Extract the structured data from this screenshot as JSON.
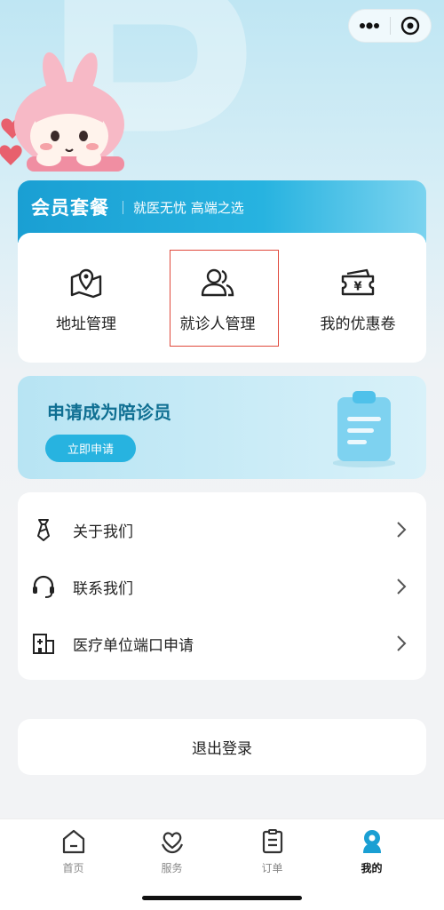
{
  "colors": {
    "accent": "#27b3e0",
    "highlight": "#e0493c",
    "title_blue": "#0f6f92"
  },
  "capsule": {
    "more_icon": "more-dots-icon",
    "close_icon": "target-circle-icon"
  },
  "member": {
    "title": "会员套餐",
    "subtitle": "就医无忧 高端之选"
  },
  "quick_actions": [
    {
      "label": "地址管理",
      "icon": "map-pin-icon"
    },
    {
      "label": "就诊人管理",
      "icon": "users-icon",
      "selected": true
    },
    {
      "label": "我的优惠卷",
      "icon": "coupon-icon"
    }
  ],
  "apply": {
    "title": "申请成为陪诊员",
    "button": "立即申请"
  },
  "menu": [
    {
      "label": "关于我们",
      "icon": "tie-icon"
    },
    {
      "label": "联系我们",
      "icon": "headset-icon"
    },
    {
      "label": "医疗单位端口申请",
      "icon": "hospital-icon"
    }
  ],
  "logout": "退出登录",
  "tabs": [
    {
      "label": "首页",
      "icon": "home-icon"
    },
    {
      "label": "服务",
      "icon": "heart-hands-icon"
    },
    {
      "label": "订单",
      "icon": "list-icon"
    },
    {
      "label": "我的",
      "icon": "profile-icon",
      "active": true
    }
  ]
}
